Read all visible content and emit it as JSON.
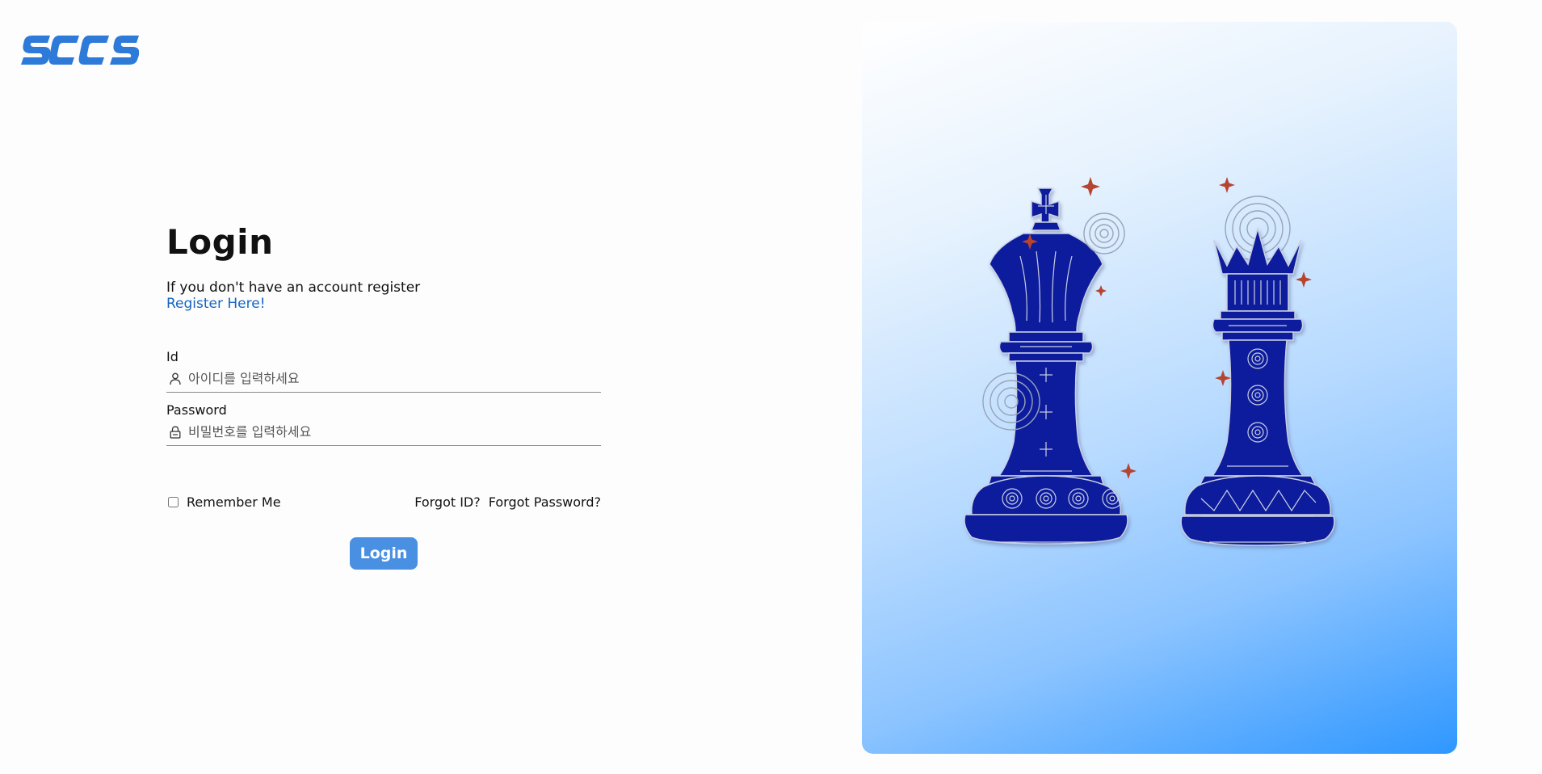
{
  "brand": {
    "logo_text": "SCCS",
    "color": "#2e7ad9"
  },
  "login": {
    "title": "Login",
    "subtitle": "If you don't have an account register",
    "register_link": "Register Here!",
    "id_label": "Id",
    "id_placeholder": "아이디를 입력하세요",
    "password_label": "Password",
    "password_placeholder": "비밀번호를 입력하세요",
    "remember_label": "Remember Me",
    "remember_checked": false,
    "forgot_id": "Forgot ID?",
    "forgot_password": "Forgot Password?",
    "submit_label": "Login"
  },
  "hero": {
    "image": "chess-king-and-queen-illustration",
    "colors": {
      "piece": "#0a1f9c",
      "accent_star": "#b5452f",
      "gradient_end": "#2f97ff"
    }
  }
}
